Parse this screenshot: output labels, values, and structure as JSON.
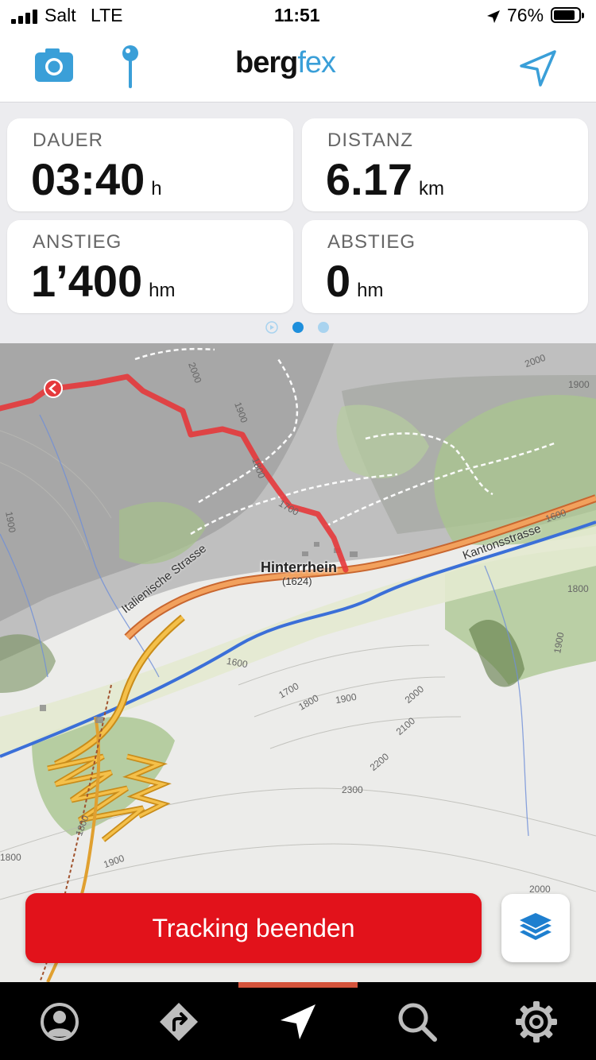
{
  "status_bar": {
    "carrier": "Salt",
    "network": "LTE",
    "time": "11:51",
    "battery": "76%"
  },
  "header": {
    "logo_part1": "berg",
    "logo_part2": "fex"
  },
  "stats": [
    {
      "label": "DAUER",
      "value": "03:40",
      "unit": "h"
    },
    {
      "label": "DISTANZ",
      "value": "6.17",
      "unit": "km"
    },
    {
      "label": "ANSTIEG",
      "value": "1’400",
      "unit": "hm"
    },
    {
      "label": "ABSTIEG",
      "value": "0",
      "unit": "hm"
    }
  ],
  "map": {
    "place": "Hinterrhein",
    "place_elevation": "(1624)",
    "road_left": "Italienische Strasse",
    "road_right": "Kantonsstrasse",
    "contours": [
      "2000",
      "1900",
      "1800",
      "1700",
      "1600",
      "1700",
      "1800",
      "1900",
      "2000",
      "2100",
      "2200",
      "2300",
      "1800",
      "1900",
      "1800",
      "1900",
      "1900",
      "2000",
      "1600",
      "1800",
      "1900",
      "1800",
      "2000"
    ]
  },
  "actions": {
    "tracking_button": "Tracking beenden"
  },
  "tabs": [
    "profile",
    "routes",
    "navigation",
    "search",
    "settings"
  ],
  "colors": {
    "accent": "#3a9fd8",
    "track": "#e2121b",
    "tab_active": "#d4543c"
  }
}
